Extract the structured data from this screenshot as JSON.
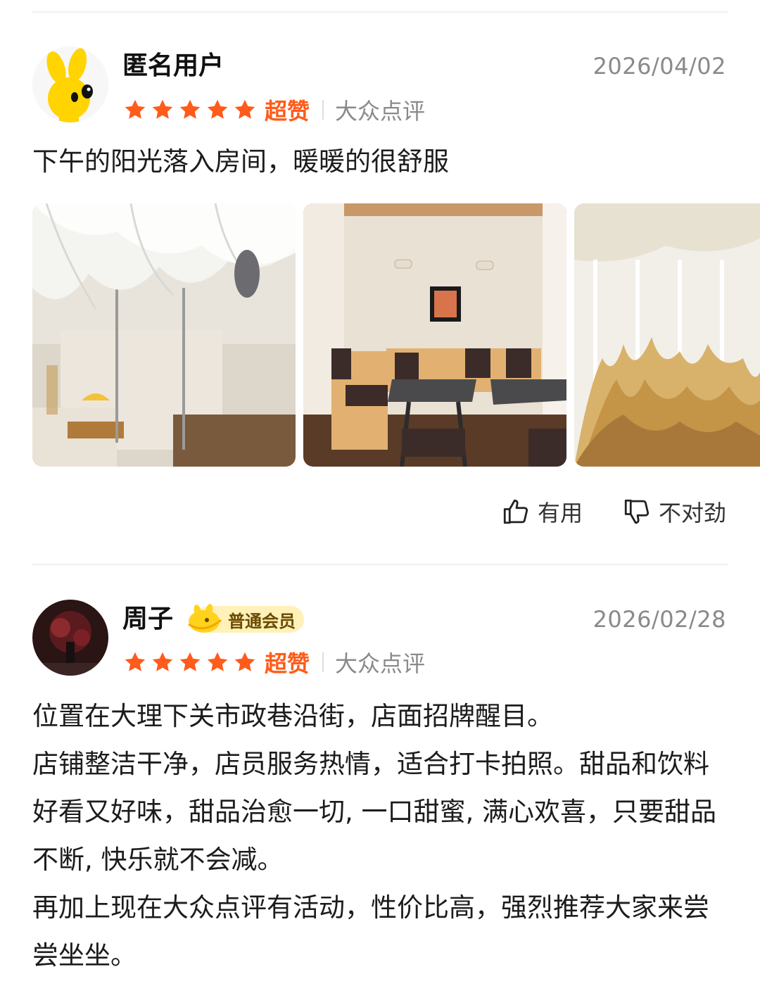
{
  "reviews": [
    {
      "username": "匿名用户",
      "date": "2026/04/02",
      "rating_word": "超赞",
      "source": "大众点评",
      "text": "下午的阳光落入房间，暖暖的很舒服",
      "photos": [
        "sheer-curtain-ceiling-room",
        "cafe-seating-area",
        "pampas-grass-curtains"
      ],
      "actions": {
        "useful": "有用",
        "wrong": "不对劲"
      }
    },
    {
      "username": "周子",
      "badge": "普通会员",
      "date": "2026/02/28",
      "rating_word": "超赞",
      "source": "大众点评",
      "text_lines": [
        "位置在大理下关市政巷沿街，店面招牌醒目。",
        "店铺整洁干净，店员服务热情，适合打卡拍照。甜品和饮料好看又好味，甜品治愈一切, 一口甜蜜, 满心欢喜，只要甜品不断, 快乐就不会减。",
        "再加上现在大众点评有活动，性价比高，强烈推荐大家来尝尝坐坐。"
      ]
    }
  ],
  "colors": {
    "accent": "#ff5b1a",
    "muted": "#8a8a8a",
    "badge_bg": "#fff1b8"
  },
  "icons": [
    "star-icon",
    "thumbs-up-icon",
    "thumbs-down-icon",
    "member-badge-icon"
  ]
}
